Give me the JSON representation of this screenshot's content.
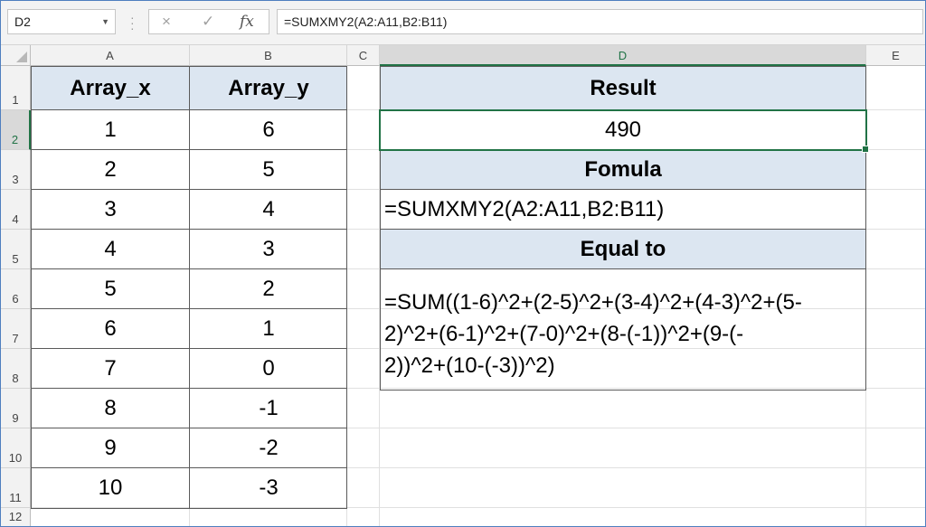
{
  "formula_bar": {
    "name_box": "D2",
    "cancel_icon": "×",
    "enter_icon": "✓",
    "fx_label": "fx",
    "formula": "=SUMXMY2(A2:A11,B2:B11)"
  },
  "columns": [
    "A",
    "B",
    "C",
    "D",
    "E"
  ],
  "rows": [
    "1",
    "2",
    "3",
    "4",
    "5",
    "6",
    "7",
    "8",
    "9",
    "10",
    "11",
    "12"
  ],
  "table": {
    "header_x": "Array_x",
    "header_y": "Array_y",
    "array_x": [
      "1",
      "2",
      "3",
      "4",
      "5",
      "6",
      "7",
      "8",
      "9",
      "10"
    ],
    "array_y": [
      "6",
      "5",
      "4",
      "3",
      "2",
      "1",
      "0",
      "-1",
      "-2",
      "-3"
    ]
  },
  "result_panel": {
    "result_label": "Result",
    "result_value": "490",
    "formula_label": "Fomula",
    "formula_text": "=SUMXMY2(A2:A11,B2:B11)",
    "equal_label": "Equal to",
    "equal_text": "=SUM((1-6)^2+(2-5)^2+(3-4)^2+(4-3)^2+(5-\n2)^2+(6-1)^2+(7-0)^2+(8-(-1))^2+(9-(-\n2))^2+(10-(-3))^2)"
  },
  "colors": {
    "header_fill": "#dce6f1",
    "selection_green": "#217346"
  }
}
